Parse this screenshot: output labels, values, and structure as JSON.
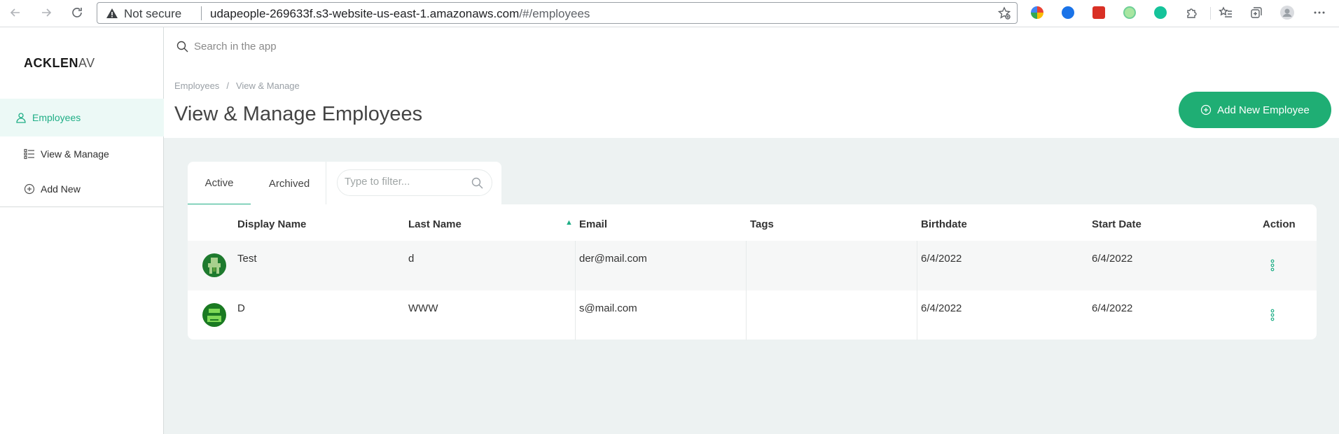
{
  "browser": {
    "security_label": "Not secure",
    "url_host": "udapeople-269633f.s3-website-us-east-1.amazonaws.com",
    "url_path": "/#/employees"
  },
  "sidebar": {
    "logo": "ACKLEN",
    "logo_faded": "AV",
    "section_label": "Employees",
    "items": [
      {
        "label": "View & Manage",
        "icon": "list-icon"
      },
      {
        "label": "Add New",
        "icon": "plus-circle-icon"
      }
    ]
  },
  "header": {
    "search_placeholder": "Search in the app",
    "breadcrumb": [
      "Employees",
      "View & Manage"
    ],
    "title": "View & Manage Employees",
    "add_button_label": "Add New Employee"
  },
  "tabs": {
    "active": "Active",
    "archived": "Archived",
    "filter_placeholder": "Type to filter..."
  },
  "table": {
    "columns": [
      "Display Name",
      "Last Name",
      "Email",
      "Tags",
      "Birthdate",
      "Start Date",
      "Action"
    ],
    "rows": [
      {
        "display_name": "Test",
        "last_name": "d",
        "email": "der@mail.com",
        "tags": "",
        "birthdate": "6/4/2022",
        "start_date": "6/4/2022"
      },
      {
        "display_name": "D",
        "last_name": "WWW",
        "email": "s@mail.com",
        "tags": "",
        "birthdate": "6/4/2022",
        "start_date": "6/4/2022"
      }
    ]
  },
  "colors": {
    "accent": "#1fae86",
    "button": "#1fae74",
    "background": "#edf2f2"
  }
}
